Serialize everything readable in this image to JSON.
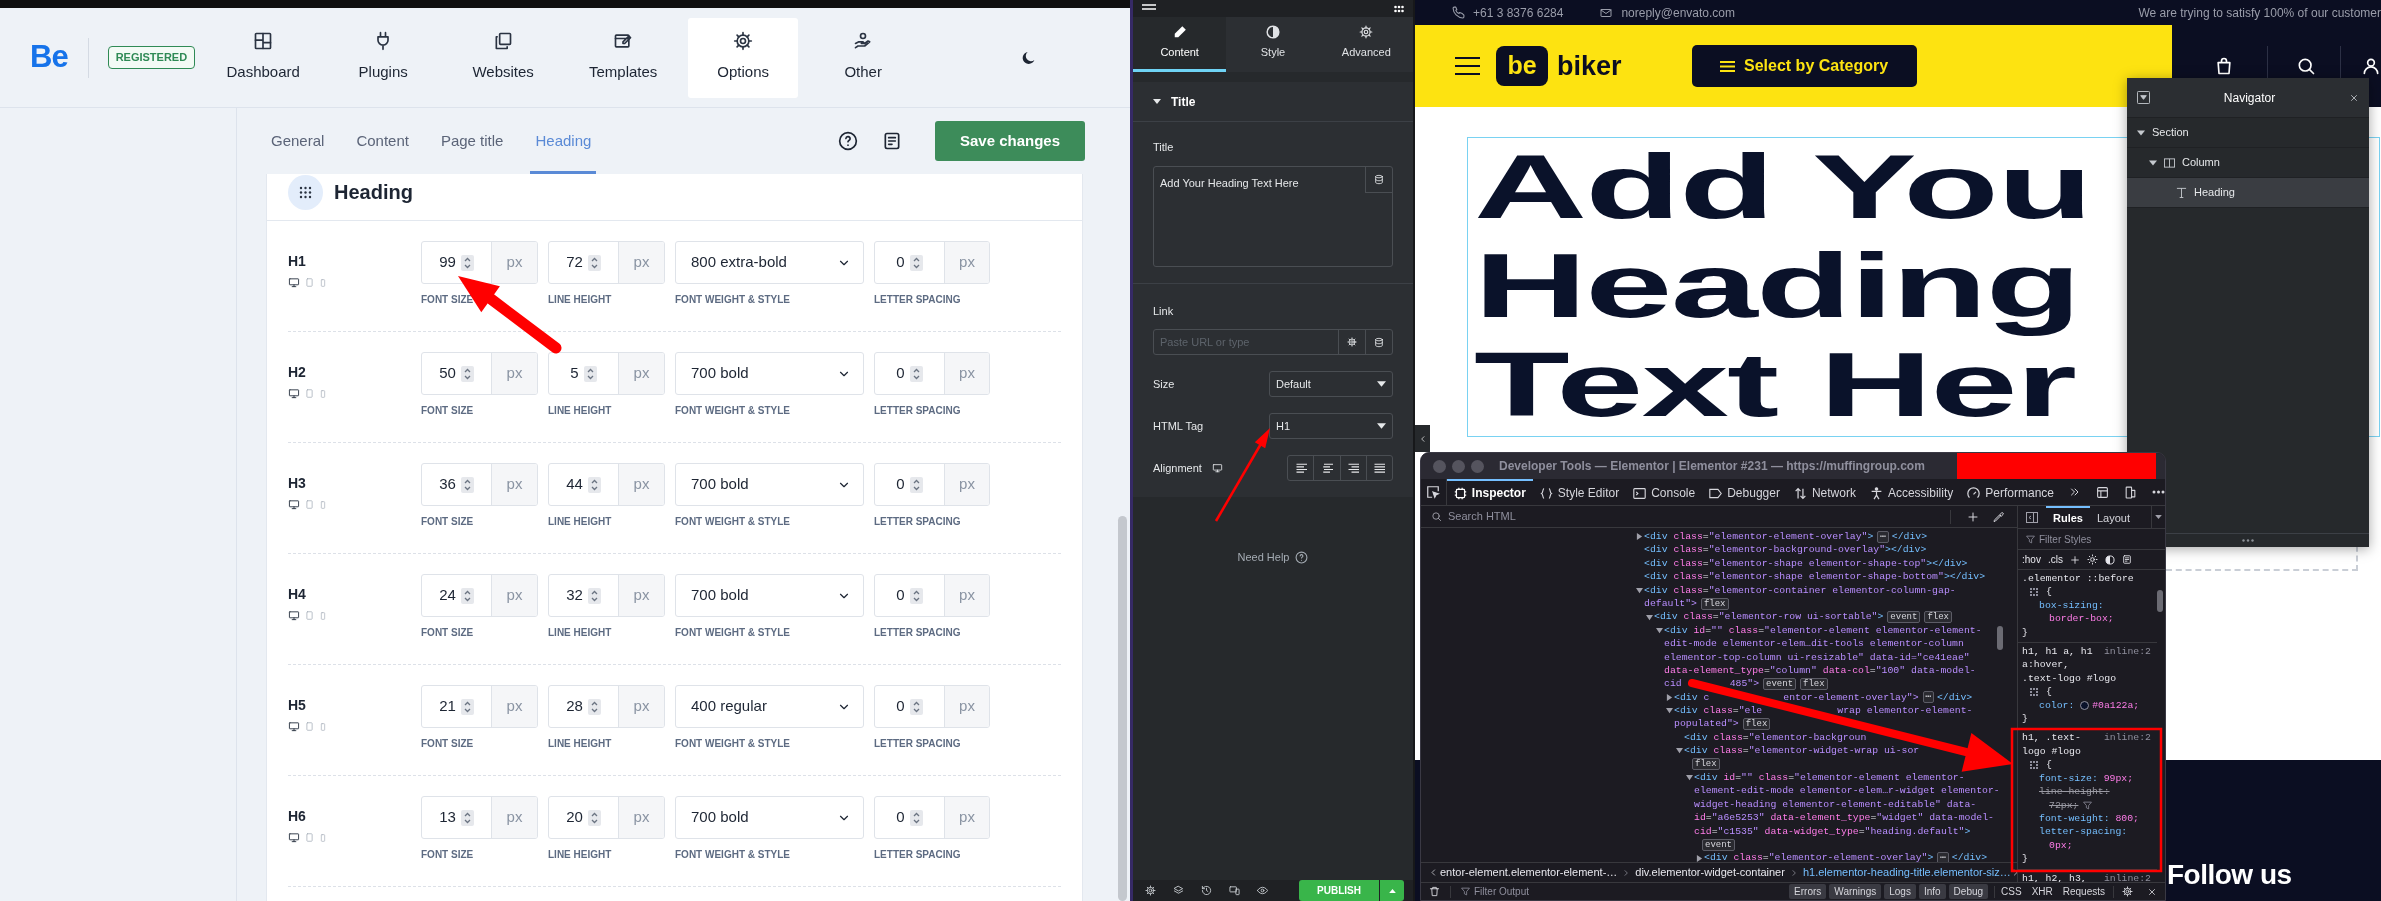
{
  "admin": {
    "logo": "Be",
    "badge": "REGISTERED",
    "nav": [
      {
        "label": "Dashboard",
        "selected": false
      },
      {
        "label": "Plugins",
        "selected": false
      },
      {
        "label": "Websites",
        "selected": false
      },
      {
        "label": "Templates",
        "selected": false
      },
      {
        "label": "Options",
        "selected": true
      },
      {
        "label": "Other",
        "selected": false
      }
    ],
    "subtabs": [
      {
        "label": "General",
        "selected": false
      },
      {
        "label": "Content",
        "selected": false
      },
      {
        "label": "Page title",
        "selected": false
      },
      {
        "label": "Heading",
        "selected": true
      }
    ],
    "save_button": "Save changes",
    "section_title": "Heading",
    "rows": [
      {
        "tag": "H1",
        "fields": [
          {
            "kind": "number",
            "value": "99",
            "unit": "px",
            "caption": "FONT SIZE"
          },
          {
            "kind": "number",
            "value": "72",
            "unit": "px",
            "caption": "LINE HEIGHT"
          },
          {
            "kind": "select",
            "value": "800 extra-bold",
            "caption": "FONT WEIGHT & STYLE"
          },
          {
            "kind": "number",
            "value": "0",
            "unit": "px",
            "caption": "LETTER SPACING"
          }
        ]
      },
      {
        "tag": "H2",
        "fields": [
          {
            "kind": "number",
            "value": "50",
            "unit": "px",
            "caption": "FONT SIZE"
          },
          {
            "kind": "number",
            "value": "5",
            "unit": "px",
            "caption": "LINE HEIGHT"
          },
          {
            "kind": "select",
            "value": "700 bold",
            "caption": "FONT WEIGHT & STYLE"
          },
          {
            "kind": "number",
            "value": "0",
            "unit": "px",
            "caption": "LETTER SPACING"
          }
        ]
      },
      {
        "tag": "H3",
        "fields": [
          {
            "kind": "number",
            "value": "36",
            "unit": "px",
            "caption": "FONT SIZE"
          },
          {
            "kind": "number",
            "value": "44",
            "unit": "px",
            "caption": "LINE HEIGHT"
          },
          {
            "kind": "select",
            "value": "700 bold",
            "caption": "FONT WEIGHT & STYLE"
          },
          {
            "kind": "number",
            "value": "0",
            "unit": "px",
            "caption": "LETTER SPACING"
          }
        ]
      },
      {
        "tag": "H4",
        "fields": [
          {
            "kind": "number",
            "value": "24",
            "unit": "px",
            "caption": "FONT SIZE"
          },
          {
            "kind": "number",
            "value": "32",
            "unit": "px",
            "caption": "LINE HEIGHT"
          },
          {
            "kind": "select",
            "value": "700 bold",
            "caption": "FONT WEIGHT & STYLE"
          },
          {
            "kind": "number",
            "value": "0",
            "unit": "px",
            "caption": "LETTER SPACING"
          }
        ]
      },
      {
        "tag": "H5",
        "fields": [
          {
            "kind": "number",
            "value": "21",
            "unit": "px",
            "caption": "FONT SIZE"
          },
          {
            "kind": "number",
            "value": "28",
            "unit": "px",
            "caption": "LINE HEIGHT"
          },
          {
            "kind": "select",
            "value": "400 regular",
            "caption": "FONT WEIGHT & STYLE"
          },
          {
            "kind": "number",
            "value": "0",
            "unit": "px",
            "caption": "LETTER SPACING"
          }
        ]
      },
      {
        "tag": "H6",
        "fields": [
          {
            "kind": "number",
            "value": "13",
            "unit": "px",
            "caption": "FONT SIZE"
          },
          {
            "kind": "number",
            "value": "20",
            "unit": "px",
            "caption": "LINE HEIGHT"
          },
          {
            "kind": "select",
            "value": "700 bold",
            "caption": "FONT WEIGHT & STYLE"
          },
          {
            "kind": "number",
            "value": "0",
            "unit": "px",
            "caption": "LETTER SPACING"
          }
        ]
      }
    ]
  },
  "editor": {
    "tabs": [
      {
        "label": "Content",
        "selected": true
      },
      {
        "label": "Style",
        "selected": false
      },
      {
        "label": "Advanced",
        "selected": false
      }
    ],
    "section": "Title",
    "title_label": "Title",
    "title_value": "Add Your Heading Text Here",
    "link_label": "Link",
    "link_placeholder": "Paste URL or type",
    "size_label": "Size",
    "size_value": "Default",
    "tag_label": "HTML Tag",
    "tag_value": "H1",
    "alignment_label": "Alignment",
    "help": "Need Help",
    "publish": "PUBLISH"
  },
  "site": {
    "topbar": [
      "+61 3 8376 6284",
      "noreply@envato.com",
      "We are trying to satisfy 100% of our customer"
    ],
    "logo_mark": "be",
    "logo_text": "biker",
    "category_button": "Select by Category",
    "heading_lines": [
      "Add You",
      "Heading",
      "Text Her"
    ],
    "footer_title": "Follow us"
  },
  "navigator": {
    "title": "Navigator",
    "items": [
      {
        "label": "Section",
        "expanded": true,
        "selected": false,
        "children": [
          {
            "label": "Column",
            "expanded": true,
            "selected": false,
            "children": [
              {
                "label": "Heading",
                "selected": true
              }
            ]
          }
        ]
      }
    ]
  },
  "devtools": {
    "title": "Developer Tools — Elementor | Elementor #231 — https://muffingroup.com",
    "tabs": [
      {
        "label": "Inspector",
        "selected": true
      },
      {
        "label": "Style Editor",
        "selected": false
      },
      {
        "label": "Console",
        "selected": false
      },
      {
        "label": "Debugger",
        "selected": false
      },
      {
        "label": "Network",
        "selected": false
      },
      {
        "label": "Accessibility",
        "selected": false
      },
      {
        "label": "Performance",
        "selected": false
      }
    ],
    "search_placeholder": "Search HTML",
    "html_lines": [
      {
        "text": "<div class=\"elementor-element-overlay\">",
        "expanded": false,
        "badges": [
          "⋯"
        ],
        "after": "</div>"
      },
      {
        "text": "<div class=\"elementor-background-overlay\"></div>"
      },
      {
        "text": "<div class=\"elementor-shape elementor-shape-top\"></div>"
      },
      {
        "text": "<div class=\"elementor-shape elementor-shape-bottom\"></div>"
      },
      {
        "text": "<div class=\"elementor-container elementor-column-gap-",
        "expanded": true
      },
      {
        "text": "default\">",
        "badges": [
          "flex"
        ]
      },
      {
        "text": "<div class=\"elementor-row ui-sortable\">",
        "expanded": true,
        "badges": [
          "event",
          "flex"
        ]
      },
      {
        "text": "<div id=\"\" class=\"elementor-element elementor-element-",
        "expanded": true
      },
      {
        "text": "edit-mode elementor-elem…dit-tools elementor-column"
      },
      {
        "text": "elementor-top-column ui-resizable\" data-id=\"ce41eae\""
      },
      {
        "text": "data-element_type=\"column\" data-col=\"100\" data-model-"
      },
      {
        "text": "cid",
        "tail": "485\">",
        "badges": [
          "event",
          "flex"
        ]
      },
      {
        "text": "<div c",
        "expanded": false,
        "tail": "entor-element-overlay\">",
        "badges": [
          "⋯"
        ],
        "after": "</div>"
      },
      {
        "text": "<div class=\"ele",
        "expanded": true,
        "tail": "wrap elementor-element-"
      },
      {
        "text": "populated\">",
        "badges": [
          "flex"
        ]
      },
      {
        "text": "<div class=\"elementor-backgroun"
      },
      {
        "text": "<div class=\"elementor-widget-wrap ui-sor",
        "expanded": true
      },
      {
        "badges": [
          "flex"
        ]
      },
      {
        "text": "<div id=\"\" class=\"elementor-element elementor-",
        "expanded": true
      },
      {
        "text": "element-edit-mode elementor-elem…r-widget elementor-"
      },
      {
        "text": "widget-heading elementor-element-editable\" data-"
      },
      {
        "text": "id=\"a6e5253\" data-element_type=\"widget\" data-model-"
      },
      {
        "text": "cid=\"c1535\" data-widget_type=\"heading.default\">"
      },
      {
        "badges": [
          "event"
        ]
      },
      {
        "text": "<div class=\"elementor-element-overlay\">",
        "expanded": false,
        "badges": [
          "⋯"
        ],
        "after": "</div>"
      }
    ],
    "breadcrumbs": [
      {
        "label": "entor-element.elementor-element-…",
        "selected": false
      },
      {
        "label": "div.elementor-widget-container",
        "selected": false
      },
      {
        "label": "h1.elementor-heading-title.elementor-siz…",
        "selected": true
      }
    ],
    "side_tabs": [
      {
        "label": "Rules",
        "selected": true
      },
      {
        "label": "Layout",
        "selected": false
      }
    ],
    "filter_placeholder": "Filter Styles",
    "pseudo_toggle": ":hov",
    "class_toggle": ".cls",
    "rules": [
      {
        "selectors": [
          ".elementor ::before"
        ],
        "open": "{",
        "close": "}",
        "declarations": [
          {
            "property": "box-sizing:",
            "value": "border-box;",
            "overridden": false
          }
        ]
      },
      {
        "selectors": [
          "h1, h1 a, h1",
          "a:hover,",
          ".text-logo #logo"
        ],
        "source": "inline:2",
        "open": "{",
        "close": "}",
        "declarations": [
          {
            "property": "color:",
            "value": "#0a122a;",
            "overridden": false,
            "color": "#0a122a"
          }
        ]
      },
      {
        "selectors": [
          "h1, .text-",
          "logo #logo"
        ],
        "source": "inline:2",
        "open": "{",
        "close": "}",
        "declarations": [
          {
            "property": "font-size:",
            "value": "99px;",
            "overridden": false
          },
          {
            "property": "line-height:",
            "value": "72px;",
            "overridden": true
          },
          {
            "property": "font-weight:",
            "value": "800;",
            "overridden": false
          },
          {
            "property": "letter-spacing:",
            "value": "0px;",
            "overridden": false
          }
        ]
      },
      {
        "selectors": [
          "h1, h2, h3,"
        ],
        "source": "inline:2"
      }
    ],
    "console_placeholder": "Filter Output",
    "levels": [
      "Errors",
      "Warnings",
      "Logs",
      "Info",
      "Debug"
    ],
    "request_types": [
      "CSS",
      "XHR",
      "Requests"
    ]
  }
}
